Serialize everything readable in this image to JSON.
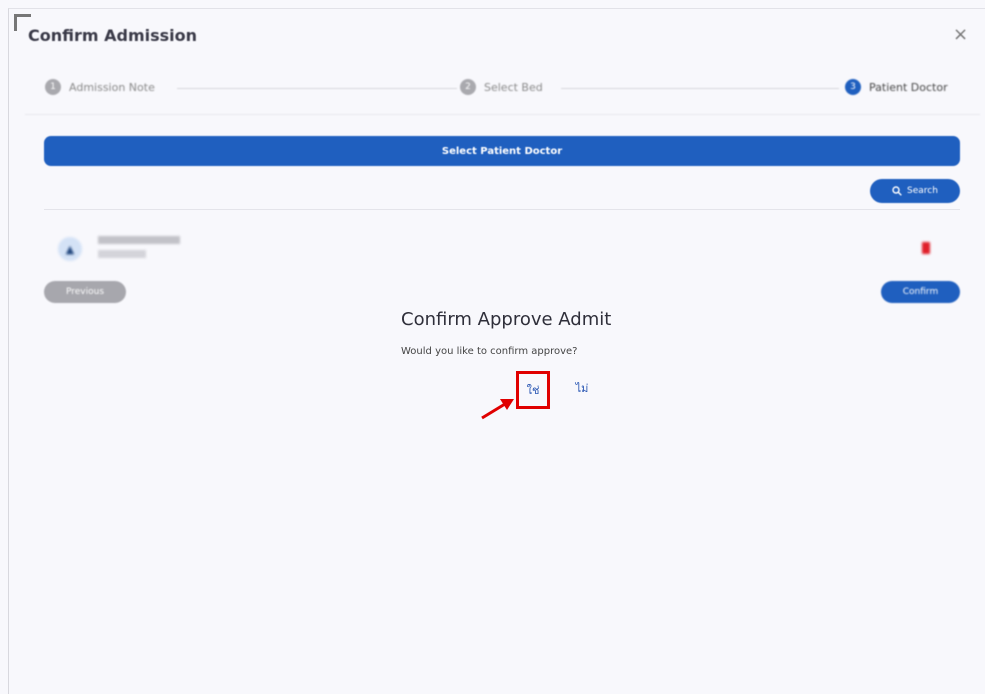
{
  "modal": {
    "title": "Confirm Admission",
    "close_glyph": "×"
  },
  "stepper": {
    "steps": [
      {
        "label": "Admission Note",
        "number": "1"
      },
      {
        "label": "Select Bed",
        "number": "2"
      },
      {
        "label": "Patient Doctor",
        "number": "3"
      }
    ],
    "active_step": "Patient Doctor"
  },
  "select_doctor": {
    "label": "Select Patient Doctor",
    "search_label": "Search"
  },
  "doctor_list": {
    "items": [
      {
        "icon": "user-icon",
        "action_icon": "trash-icon"
      }
    ]
  },
  "footer": {
    "previous_label": "Previous",
    "confirm_label": "Confirm"
  },
  "dialog": {
    "title": "Confirm Approve Admit",
    "message": "Would you like to confirm approve?",
    "yes_label": "ใช่",
    "no_label": "ไม่"
  },
  "annotation": {
    "highlight_color": "#e00000",
    "arrow_icon": "red-arrow-icon"
  },
  "colors": {
    "primary": "#1f5fbf",
    "danger": "#e0202a",
    "muted": "#a7a7ad"
  }
}
